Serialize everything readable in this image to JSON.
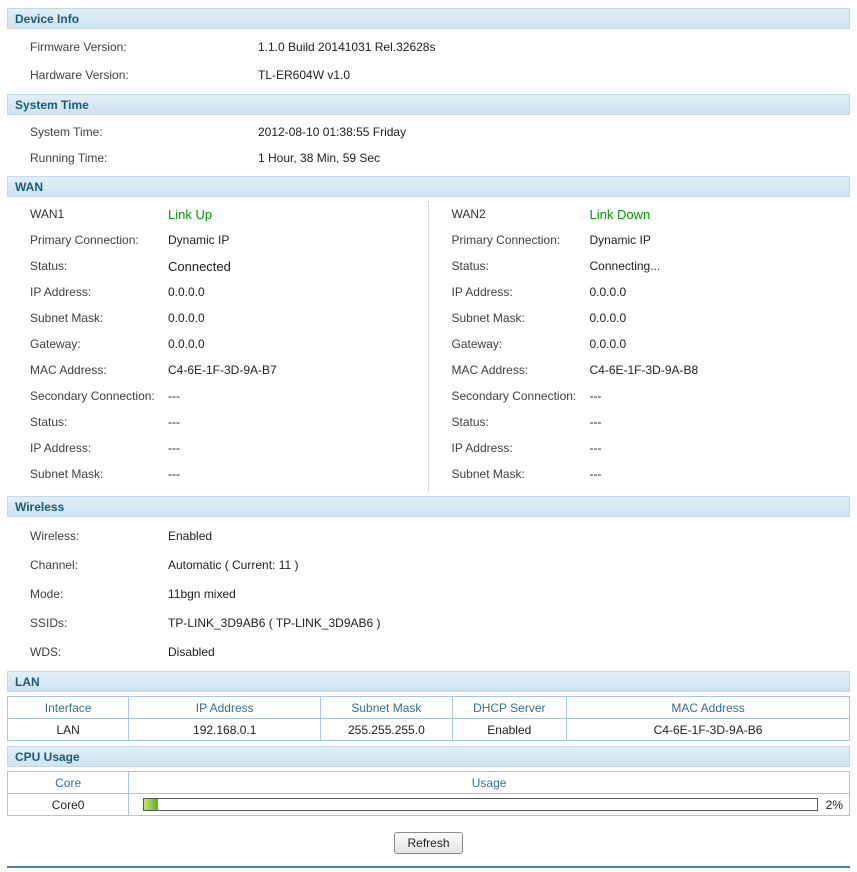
{
  "device_info": {
    "title": "Device Info",
    "rows": [
      {
        "label": "Firmware Version:",
        "value": "1.1.0 Build 20141031 Rel.32628s"
      },
      {
        "label": "Hardware Version:",
        "value": "TL-ER604W v1.0"
      }
    ]
  },
  "system_time": {
    "title": "System Time",
    "rows": [
      {
        "label": "System Time:",
        "value": "2012-08-10 01:38:55 Friday"
      },
      {
        "label": "Running Time:",
        "value": "1 Hour, 38 Min, 59 Sec"
      }
    ]
  },
  "wan": {
    "title": "WAN",
    "columns": [
      {
        "name": "WAN1",
        "link_status": "Link Up",
        "rows": [
          {
            "label": "Primary Connection:",
            "value": "Dynamic IP"
          },
          {
            "label": "Status:",
            "value": "Connected"
          },
          {
            "label": "IP Address:",
            "value": "0.0.0.0"
          },
          {
            "label": "Subnet Mask:",
            "value": "0.0.0.0"
          },
          {
            "label": "Gateway:",
            "value": "0.0.0.0"
          },
          {
            "label": "MAC Address:",
            "value": "C4-6E-1F-3D-9A-B7"
          },
          {
            "label": "Secondary Connection:",
            "value": "---"
          },
          {
            "label": "Status:",
            "value": "---"
          },
          {
            "label": "IP Address:",
            "value": "---"
          },
          {
            "label": "Subnet Mask:",
            "value": "---"
          }
        ]
      },
      {
        "name": "WAN2",
        "link_status": "Link Down",
        "rows": [
          {
            "label": "Primary Connection:",
            "value": "Dynamic IP"
          },
          {
            "label": "Status:",
            "value": "Connecting..."
          },
          {
            "label": "IP Address:",
            "value": "0.0.0.0"
          },
          {
            "label": "Subnet Mask:",
            "value": "0.0.0.0"
          },
          {
            "label": "Gateway:",
            "value": "0.0.0.0"
          },
          {
            "label": "MAC Address:",
            "value": "C4-6E-1F-3D-9A-B8"
          },
          {
            "label": "Secondary Connection:",
            "value": "---"
          },
          {
            "label": "Status:",
            "value": "---"
          },
          {
            "label": "IP Address:",
            "value": "---"
          },
          {
            "label": "Subnet Mask:",
            "value": "---"
          }
        ]
      }
    ]
  },
  "wireless": {
    "title": "Wireless",
    "rows": [
      {
        "label": "Wireless:",
        "value": "Enabled"
      },
      {
        "label": "Channel:",
        "value": "Automatic ( Current: 11 )"
      },
      {
        "label": "Mode:",
        "value": "11bgn mixed"
      },
      {
        "label": "SSIDs:",
        "value": "TP-LINK_3D9AB6 ( TP-LINK_3D9AB6 )"
      },
      {
        "label": "WDS:",
        "value": "Disabled"
      }
    ]
  },
  "lan": {
    "title": "LAN",
    "headers": [
      "Interface",
      "IP Address",
      "Subnet Mask",
      "DHCP Server",
      "MAC Address"
    ],
    "row": [
      "LAN",
      "192.168.0.1",
      "255.255.255.0",
      "Enabled",
      "C4-6E-1F-3D-9A-B6"
    ]
  },
  "cpu": {
    "title": "CPU Usage",
    "headers": [
      "Core",
      "Usage"
    ],
    "core_label": "Core0",
    "usage_percent": 2,
    "usage_label": "2%"
  },
  "footer": {
    "refresh_label": "Refresh"
  },
  "colors": {
    "section_title": "#1a5b7c",
    "section_bar_bg": "#cfe2ee",
    "link_status_green": "#009900",
    "cpu_bar_green": "#5fae2d",
    "table_border": "#a9c8da",
    "footer_line_blue": "#4580aa"
  }
}
